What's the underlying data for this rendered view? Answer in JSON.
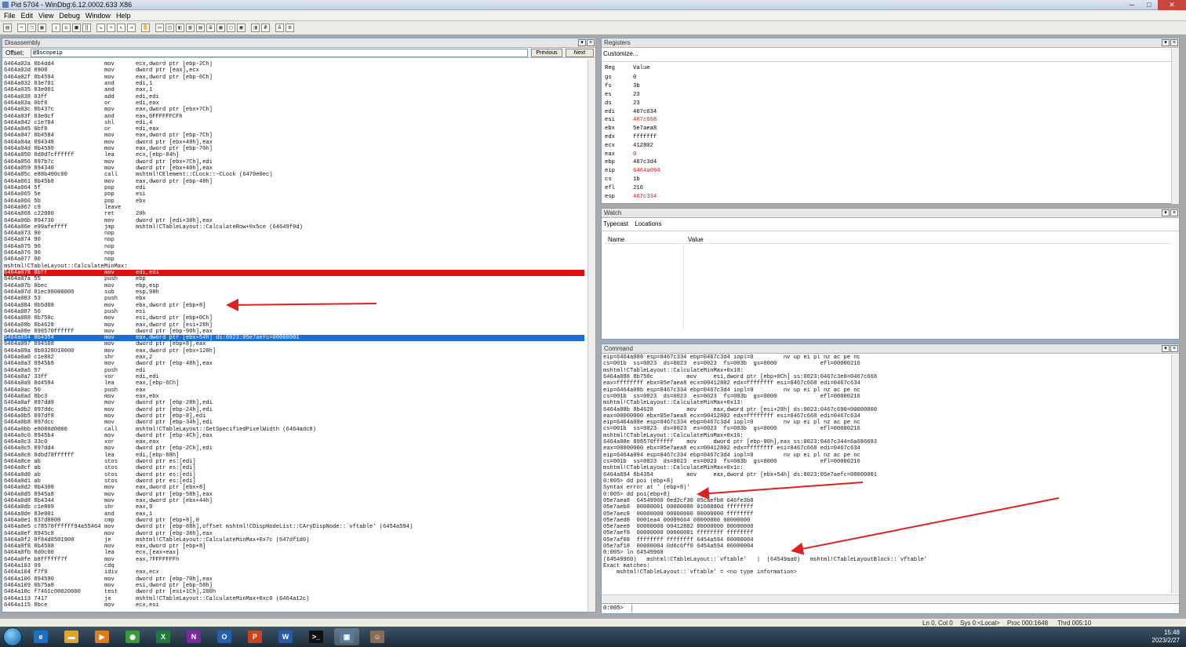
{
  "window": {
    "title": "Pid 5704 - WinDbg:6.12.0002.633 X86"
  },
  "menu": [
    "File",
    "Edit",
    "View",
    "Debug",
    "Window",
    "Help"
  ],
  "disassembly": {
    "title": "Disassembly",
    "offset_label": "Offset:",
    "offset_value": "@$scopeip",
    "previous_label": "Previous",
    "next_label": "Next",
    "lines": [
      [
        "6464a02a 8b4dd4",
        "mov",
        "ecx,dword ptr [ebp-2Ch]"
      ],
      [
        "6464a02d 8908",
        "mov",
        "dword ptr [eax],ecx"
      ],
      [
        "6464a02f 8b4594",
        "mov",
        "eax,dword ptr [ebp-6Ch]"
      ],
      [
        "6464a032 83e701",
        "and",
        "edi,1"
      ],
      [
        "6464a035 83e001",
        "and",
        "eax,1"
      ],
      [
        "6464a038 03ff",
        "add",
        "edi,edi"
      ],
      [
        "6464a03a 0bf8",
        "or",
        "edi,eax"
      ],
      [
        "6464a03c 8b437c",
        "mov",
        "eax,dword ptr [ebx+7Ch]"
      ],
      [
        "6464a03f 83e0cf",
        "and",
        "eax,0FFFFFFCFh"
      ],
      [
        "6464a042 c1e704",
        "shl",
        "edi,4"
      ],
      [
        "6464a045 0bf8",
        "or",
        "edi,eax"
      ],
      [
        "6464a047 8b4584",
        "mov",
        "eax,dword ptr [ebp-7Ch]"
      ],
      [
        "6464a04a 894348",
        "mov",
        "dword ptr [ebx+48h],eax"
      ],
      [
        "6464a04d 8b4590",
        "mov",
        "eax,dword ptr [ebp-70h]"
      ],
      [
        "6464a050 8d8d7cffffff",
        "lea",
        "ecx,[ebp-84h]"
      ],
      [
        "6464a056 897b7c",
        "mov",
        "dword ptr [ebx+7Ch],edi"
      ],
      [
        "6464a059 894340",
        "mov",
        "dword ptr [ebx+40h],eax"
      ],
      [
        "6464a05c e88b400c00",
        "call",
        "mshtml!CElement::CLock::~CLock (6470e0ec)"
      ],
      [
        "6464a061 8b45b8",
        "mov",
        "eax,dword ptr [ebp-48h]"
      ],
      [
        "6464a064 5f",
        "pop",
        "edi"
      ],
      [
        "6464a065 5e",
        "pop",
        "esi"
      ],
      [
        "6464a066 5b",
        "pop",
        "ebx"
      ],
      [
        "6464a067 c9",
        "leave",
        ""
      ],
      [
        "6464a068 c22000",
        "ret",
        "20h"
      ],
      [
        "6464a06b 894730",
        "mov",
        "dword ptr [edi+30h],eax"
      ],
      [
        "6464a06e e99afeffff",
        "jmp",
        "mshtml!CTableLayout::CalculateRow+0x5ce (64649f0d)"
      ],
      [
        "6464a073 90",
        "nop",
        ""
      ],
      [
        "6464a074 90",
        "nop",
        ""
      ],
      [
        "6464a075 90",
        "nop",
        ""
      ],
      [
        "6464a076 90",
        "nop",
        ""
      ],
      [
        "6464a077 90",
        "nop",
        ""
      ],
      [
        "mshtml!CTableLayout::CalculateMinMax:",
        "",
        ""
      ],
      [
        "6464a078 8bff",
        "mov",
        "edi,edi"
      ],
      [
        "6464a07a 55",
        "push",
        "ebp"
      ],
      [
        "6464a07b 8bec",
        "mov",
        "ebp,esp"
      ],
      [
        "6464a07d 81ec98000000",
        "sub",
        "esp,98h"
      ],
      [
        "6464a083 53",
        "push",
        "ebx"
      ],
      [
        "6464a084 8b5d08",
        "mov",
        "ebx,dword ptr [ebp+8]"
      ],
      [
        "6464a087 56",
        "push",
        "esi"
      ],
      [
        "6464a088 8b750c",
        "mov",
        "esi,dword ptr [ebp+0Ch]"
      ],
      [
        "6464a08b 8b4628",
        "mov",
        "eax,dword ptr [esi+28h]"
      ],
      [
        "6464a08e 898570ffffff",
        "mov",
        "dword ptr [ebp-90h],eax"
      ],
      [
        "6464a094 8b4354",
        "mov",
        "eax,dword ptr [ebx+54h] ds:0023:05e7aefc=00000001"
      ],
      [
        "6464a097 894508",
        "mov",
        "dword ptr [ebp+8],eax"
      ],
      [
        "6464a09a 8b8328010000",
        "mov",
        "eax,dword ptr [ebx+128h]"
      ],
      [
        "6464a0a0 c1e802",
        "shr",
        "eax,2"
      ],
      [
        "6464a0a3 8945b8",
        "mov",
        "dword ptr [ebp-48h],eax"
      ],
      [
        "6464a0a6 57",
        "push",
        "edi"
      ],
      [
        "6464a0a7 33ff",
        "xor",
        "edi,edi"
      ],
      [
        "6464a0a9 8d4594",
        "lea",
        "eax,[ebp-6Ch]"
      ],
      [
        "6464a0ac 50",
        "push",
        "eax"
      ],
      [
        "6464a0ad 8bc3",
        "mov",
        "eax,ebx"
      ],
      [
        "6464a0af 897dd8",
        "mov",
        "dword ptr [ebp-28h],edi"
      ],
      [
        "6464a0b2 897ddc",
        "mov",
        "dword ptr [ebp-24h],edi"
      ],
      [
        "6464a0b5 897df8",
        "mov",
        "dword ptr [ebp-8],edi"
      ],
      [
        "6464a0b8 897dcc",
        "mov",
        "dword ptr [ebp-34h],edi"
      ],
      [
        "6464a0bb e8080d0000",
        "call",
        "mshtml!CTableLayout::GetSpecifiedPixelWidth (6464adc8)"
      ],
      [
        "6464a0c0 8945b4",
        "mov",
        "dword ptr [ebp-4Ch],eax"
      ],
      [
        "6464a0c3 33c0",
        "xor",
        "eax,eax"
      ],
      [
        "6464a0c5 897dd4",
        "mov",
        "dword ptr [ebp-2Ch],edi"
      ],
      [
        "6464a0c8 8dbd78ffffff",
        "lea",
        "edi,[ebp-88h]"
      ],
      [
        "6464a0ce ab",
        "stos",
        "dword ptr es:[edi]"
      ],
      [
        "6464a0cf ab",
        "stos",
        "dword ptr es:[edi]"
      ],
      [
        "6464a0d0 ab",
        "stos",
        "dword ptr es:[edi]"
      ],
      [
        "6464a0d1 ab",
        "stos",
        "dword ptr es:[edi]"
      ],
      [
        "6464a0d2 8b4308",
        "mov",
        "eax,dword ptr [ebx+8]"
      ],
      [
        "6464a0d5 8945a8",
        "mov",
        "dword ptr [ebp-58h],eax"
      ],
      [
        "6464a0d8 8b4344",
        "mov",
        "eax,dword ptr [ebx+44h]"
      ],
      [
        "6464a0db c1e809",
        "shr",
        "eax,9"
      ],
      [
        "6464a0de 83e001",
        "and",
        "eax,1"
      ],
      [
        "6464a0e1 837d0800",
        "cmp",
        "dword ptr [ebp+8],0"
      ],
      [
        "6464a0e5 c78578ffffff94a55464",
        "mov",
        "dword ptr [ebp-88h],offset mshtml!CDispNodeList::CAryDispNode::`vftable' (6454a594)"
      ],
      [
        "6464a0ef 8945c8",
        "mov",
        "dword ptr [ebp-38h],eax"
      ],
      [
        "6464a0f2 0f84d8501900",
        "je",
        "mshtml!CTableLayout::CalculateMinMax+0x7c (647df1d0)"
      ],
      [
        "6464a0f8 8b4508",
        "mov",
        "eax,dword ptr [ebp+8]"
      ],
      [
        "6464a0fb 8d0c00",
        "lea",
        "ecx,[eax+eax]"
      ],
      [
        "6464a0fe b8ffffff7f",
        "mov",
        "eax,7FFFFFFFh"
      ],
      [
        "6464a103 99",
        "cdq",
        ""
      ],
      [
        "6464a104 f7f9",
        "idiv",
        "eax,ecx"
      ],
      [
        "6464a106 894590",
        "mov",
        "dword ptr [ebp-70h],eax"
      ],
      [
        "6464a109 8b75a8",
        "mov",
        "esi,dword ptr [ebp-58h]"
      ],
      [
        "6464a10c f7461c00020000",
        "test",
        "dword ptr [esi+1Ch],200h"
      ],
      [
        "6464a113 7417",
        "je",
        "mshtml!CTableLayout::CalculateMinMax+0xc0 (6464a12c)"
      ],
      [
        "6464a115 8bce",
        "mov",
        "ecx,esi"
      ]
    ]
  },
  "registers": {
    "title": "Registers",
    "customize": "Customize...",
    "col_reg": "Reg",
    "col_value": "Value",
    "rows": [
      {
        "r": "gs",
        "v": "0",
        "changed": false
      },
      {
        "r": "fs",
        "v": "3b",
        "changed": false
      },
      {
        "r": "es",
        "v": "23",
        "changed": false
      },
      {
        "r": "ds",
        "v": "23",
        "changed": false
      },
      {
        "r": "edi",
        "v": "467c634",
        "changed": false
      },
      {
        "r": "esi",
        "v": "467c668",
        "changed": true
      },
      {
        "r": "ebx",
        "v": "5e7aea8",
        "changed": false
      },
      {
        "r": "edx",
        "v": "fffffff",
        "changed": false
      },
      {
        "r": "ecx",
        "v": "412802",
        "changed": false
      },
      {
        "r": "eax",
        "v": "0",
        "changed": true
      },
      {
        "r": "ebp",
        "v": "467c3d4",
        "changed": false
      },
      {
        "r": "eip",
        "v": "6464a094",
        "changed": true
      },
      {
        "r": "cs",
        "v": "1b",
        "changed": false
      },
      {
        "r": "efl",
        "v": "216",
        "changed": false
      },
      {
        "r": "esp",
        "v": "467c334",
        "changed": true
      }
    ]
  },
  "watch": {
    "title": "Watch",
    "tabs": [
      "Typecast",
      "Locations"
    ],
    "col_name": "Name",
    "col_value": "Value"
  },
  "command": {
    "title": "Command",
    "prompt": "0:005>",
    "input": "",
    "lines": [
      "eip=6464a088 esp=0467c334 ebp=0467c3d4 iopl=0         nv up ei pl nz ac pe nc",
      "cs=001b  ss=0023  ds=0023  es=0023  fs=003b  gs=0000             efl=00000216",
      "mshtml!CTableLayout::CalculateMinMax+0x10:",
      "6464a088 8b750c          mov     esi,dword ptr [ebp+0Ch] ss:0023:0467c3e0=0467c668",
      "eax=ffffffff ebx=05e7aea8 ecx=00412802 edx=ffffffff esi=0467c668 edi=0467c634",
      "eip=6464a08b esp=0467c334 ebp=0467c3d4 iopl=0         nv up ei pl nz ac pe nc",
      "cs=001b  ss=0023  ds=0023  es=0023  fs=003b  gs=0000             efl=00000216",
      "mshtml!CTableLayout::CalculateMinMax+0x13:",
      "6464a08b 8b4628          mov     eax,dword ptr [esi+28h] ds:0023:0467c690=00000000",
      "eax=00000000 ebx=05e7aea8 ecx=00412802 edx=ffffffff esi=0467c668 edi=0467c634",
      "eip=6464a08e esp=0467c334 ebp=0467c3d4 iopl=0         nv up ei pl nz ac pe nc",
      "cs=001b  ss=0023  ds=0023  es=0023  fs=003b  gs=0000             efl=00000216",
      "mshtml!CTableLayout::CalculateMinMax+0x16:",
      "6464a08e 898570ffffff    mov     dword ptr [ebp-90h],eax ss:0023:0467c344=6a686693",
      "eax=00000000 ebx=05e7aea8 ecx=00412802 edx=ffffffff esi=0467c668 edi=0467c634",
      "eip=6464a094 esp=0467c334 ebp=0467c3d4 iopl=0         nv up ei pl nz ac pe nc",
      "cs=001b  ss=0023  ds=0023  es=0023  fs=003b  gs=0000             efl=00000216",
      "mshtml!CTableLayout::CalculateMinMax+0x1c:",
      "6464a094 8b4354          mov     eax,dword ptr [ebx+54h] ds:0023:05e7aefc=00000001",
      "0:005> dd poi (ebp+8)",
      "Syntax error at ' (ebp+8)'",
      "0:005> dd poi(ebp+8)",
      "05e7aea8  64549960 0ed2cf30 05caefb8 646fe3b8",
      "05e7aeb8  00000001 00000000 0108080d ffffffff",
      "05e7aec8  00000000 00000000 00000000 ffffffff",
      "05e7aed8  0001ea4 00009664 00000000 00000000",
      "05e7aee8  00000000 00412802 00000000 00000000",
      "05e7aef8  00000000 00000001 ffffffff ffffffff",
      "05e7af08  ffffffff ffffffff 6454a594 00000004",
      "05e7af18  00000004 0d6c6ff0 6454a594 00000004",
      "0:005> ln 64549960",
      "(64549960)   mshtml!CTableLayout::`vftable'   |  (64549aa0)   mshtml!CTableLayoutBlock::`vftable'",
      "Exact matches:",
      "    mshtml!CTableLayout::`vftable' = <no type information>"
    ]
  },
  "status": {
    "position": "Ln 0, Col 0",
    "sys": "Sys 0:<Local>",
    "proc": "Proc 000:1648",
    "thrd": "Thrd 005:10"
  },
  "taskbar": {
    "apps": [
      {
        "name": "ie",
        "glyph": "e",
        "color": "#1e6fc8"
      },
      {
        "name": "explorer",
        "glyph": "▬",
        "color": "#d9a633"
      },
      {
        "name": "media",
        "glyph": "▶",
        "color": "#e07b1a"
      },
      {
        "name": "chrome",
        "glyph": "◉",
        "color": "#3a9a3a"
      },
      {
        "name": "excel",
        "glyph": "X",
        "color": "#1f7a3c"
      },
      {
        "name": "onenote",
        "glyph": "N",
        "color": "#7a2aa0"
      },
      {
        "name": "outlook",
        "glyph": "O",
        "color": "#1e62b0"
      },
      {
        "name": "powerpoint",
        "glyph": "P",
        "color": "#c8441e"
      },
      {
        "name": "word",
        "glyph": "W",
        "color": "#2a5aa8"
      },
      {
        "name": "cmd",
        "glyph": ">_",
        "color": "#111111"
      },
      {
        "name": "windbg",
        "glyph": "▣",
        "color": "#5a7a9a"
      },
      {
        "name": "photo",
        "glyph": "☺",
        "color": "#8a6a5a"
      }
    ],
    "time": "15:48",
    "date": "2023/2/27"
  }
}
